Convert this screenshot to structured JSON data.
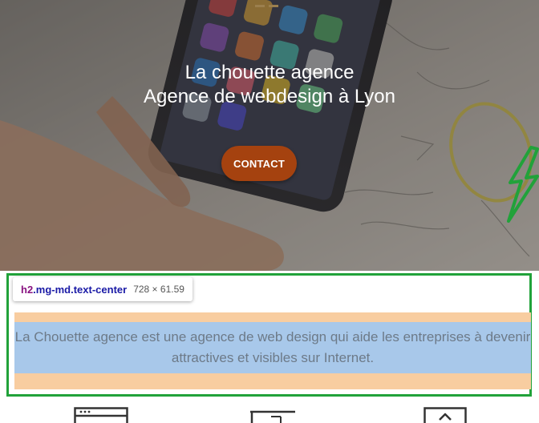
{
  "hero": {
    "title_line1": "La chouette agence",
    "title_line2": "Agence de webdesign à Lyon",
    "contact_label": "CONTACT"
  },
  "inspector": {
    "tag": "h2",
    "classes": ".mg-md.text-center",
    "dimensions": "728 × 61.59",
    "highlight_color": "#21a23a",
    "margin_color": "#f8cda0",
    "content_color": "#a8c8ea"
  },
  "intro": {
    "text": "La Chouette agence est une agence de web design qui aide les entreprises à devenir attractives et visibles sur Internet."
  },
  "colors": {
    "button": "#a5420f",
    "hero_text": "#ffffff",
    "intro_text": "#6d7a88"
  },
  "bottom_icons": [
    {
      "name": "browser-window-icon"
    },
    {
      "name": "crop-frame-icon"
    },
    {
      "name": "upload-box-icon"
    }
  ]
}
